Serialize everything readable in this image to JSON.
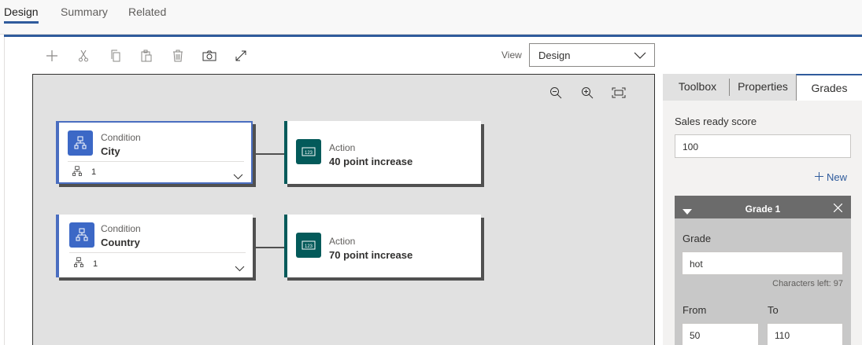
{
  "top_tabs": [
    {
      "label": "Design",
      "active": true
    },
    {
      "label": "Summary",
      "active": false
    },
    {
      "label": "Related",
      "active": false
    }
  ],
  "toolbar": {
    "icons": [
      "add-icon",
      "cut-icon",
      "copy-icon",
      "paste-icon",
      "delete-icon",
      "snapshot-icon",
      "expand-icon"
    ],
    "view_label": "View",
    "view_value": "Design"
  },
  "canvas": {
    "zoom_icons": [
      "zoom-out-icon",
      "zoom-in-icon",
      "fit-to-screen-icon"
    ],
    "rows": [
      {
        "condition": {
          "title": "Condition",
          "value": "City",
          "branch_count": "1",
          "selected": true
        },
        "action": {
          "title": "Action",
          "value": "40 point increase"
        }
      },
      {
        "condition": {
          "title": "Condition",
          "value": "Country",
          "branch_count": "1",
          "selected": false
        },
        "action": {
          "title": "Action",
          "value": "70 point increase"
        }
      }
    ]
  },
  "panel": {
    "tabs": [
      {
        "label": "Toolbox",
        "active": false
      },
      {
        "label": "Properties",
        "active": false
      },
      {
        "label": "Grades",
        "active": true
      }
    ],
    "sales_ready_label": "Sales ready score",
    "sales_ready_value": "100",
    "new_label": "New",
    "grade": {
      "title": "Grade 1",
      "grade_label": "Grade",
      "grade_value": "hot",
      "chars_left": "Characters left: 97",
      "from_label": "From",
      "from_value": "50",
      "to_label": "To",
      "to_value": "110"
    }
  },
  "colors": {
    "accent": "#2f5b9c",
    "condition": "#3c68c6",
    "action": "#035a5a",
    "canvas": "#e1e1e1"
  }
}
